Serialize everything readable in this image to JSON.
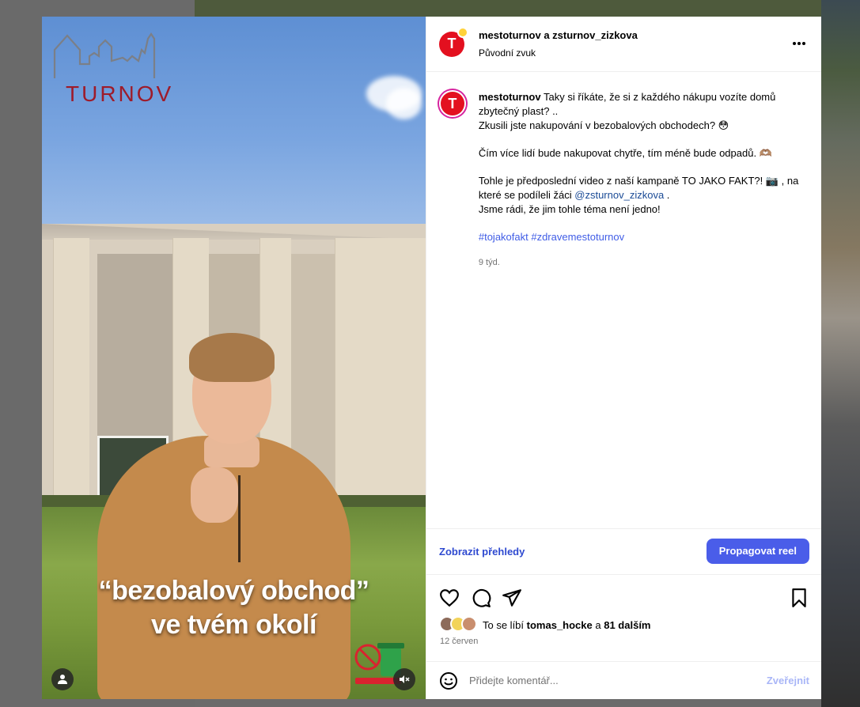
{
  "media": {
    "logo_text": "TURNOV",
    "caption_line1": "“bezobalový obchod”",
    "caption_line2": "ve tvém okolí",
    "user_tag_icon": "person-icon",
    "mute_icon": "speaker-muted-icon"
  },
  "header": {
    "authors": "mestoturnov a zsturnov_zizkova",
    "audio": "Původní zvuk",
    "avatar_letter": "T"
  },
  "post": {
    "avatar_letter": "T",
    "username": "mestoturnov",
    "line1": "Taky si říkáte, že si z každého nákupu vozíte domů zbytečný plast? ..",
    "line2": "Zkusili jste nakupování v bezobalových obchodech? 😳",
    "line3": "Čím více lidí bude nakupovat chytře, tím méně bude odpadů. 🫶🏽",
    "line4a": "Tohle je předposlední video z naší kampaně TO JAKO FAKT?! 📷 , na které se podíleli žáci",
    "mention": "@zsturnov_zizkova",
    "line4b": ".",
    "line5": "Jsme rádi, že jim tohle téma není jedno!",
    "hashtags": "#tojakofakt #zdravemestoturnov",
    "time": "9 týd."
  },
  "insights": {
    "link": "Zobrazit přehledy",
    "promote": "Propagovat reel"
  },
  "likes": {
    "prefix": "To se líbí",
    "user": "tomas_hocke",
    "joiner": "a",
    "others": "81 dalším",
    "date": "12 červen"
  },
  "comment": {
    "placeholder": "Přidejte komentář...",
    "publish": "Zveřejnit"
  },
  "colors": {
    "accent": "#4a5de9",
    "brand_red": "#e3101f"
  }
}
